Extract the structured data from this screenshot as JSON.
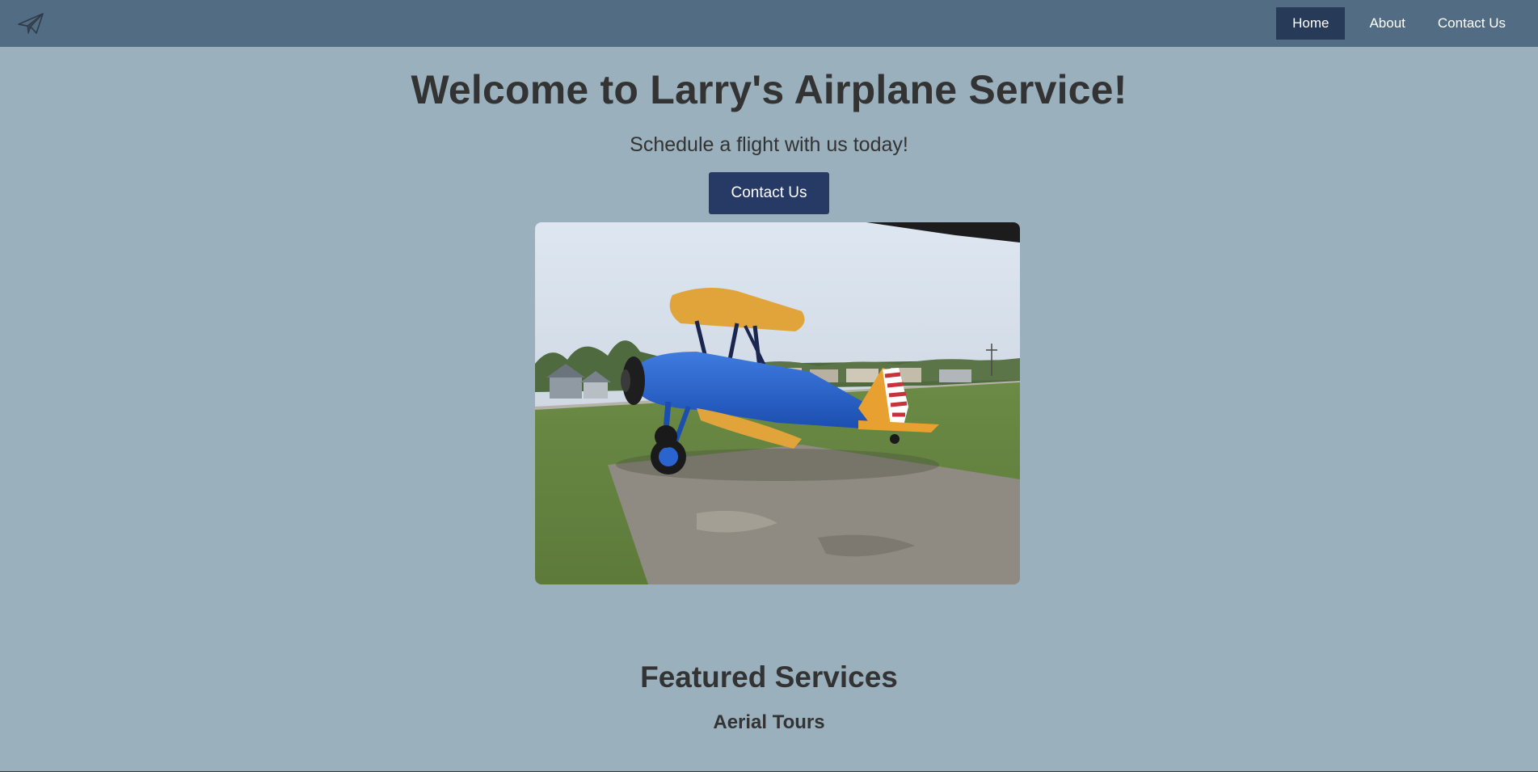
{
  "nav": {
    "logo_icon": "paper-airplane-icon",
    "links": [
      {
        "label": "Home",
        "active": true
      },
      {
        "label": "About",
        "active": false
      },
      {
        "label": "Contact Us",
        "active": false
      }
    ]
  },
  "hero": {
    "title": "Welcome to Larry's Airplane Service!",
    "subtitle": "Schedule a flight with us today!",
    "cta_label": "Contact Us",
    "image_alt": "Blue and yellow biplane parked on a concrete pad"
  },
  "services": {
    "title": "Featured Services",
    "first_service": "Aerial Tours"
  },
  "colors": {
    "background": "#9bb0bd",
    "navbar": "#526c83",
    "active_nav": "#273a58",
    "button": "#273a65",
    "text": "#333333"
  }
}
